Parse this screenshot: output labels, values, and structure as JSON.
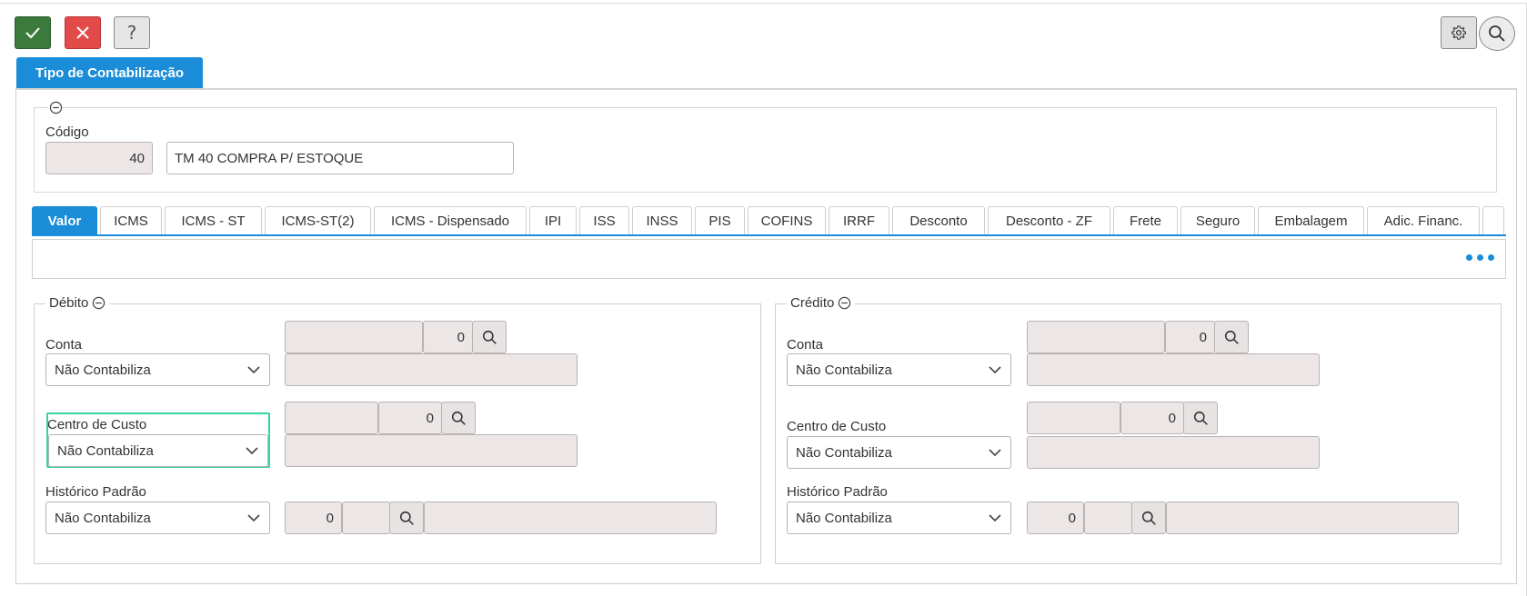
{
  "toolbar": {
    "ok_icon": "check-icon",
    "cancel_icon": "x-icon",
    "help_label": "?",
    "colors": {
      "ok": "#3a7a3a",
      "cancel": "#e34a4a",
      "accent": "#1a8cd8",
      "focus": "#33d6a0"
    }
  },
  "page": {
    "main_tab": "Tipo de Contabilização"
  },
  "header": {
    "code_label": "Código",
    "code_value": "40",
    "description_value": "TM 40 COMPRA P/ ESTOQUE"
  },
  "tabs": [
    {
      "label": "Valor",
      "active": true
    },
    {
      "label": "ICMS"
    },
    {
      "label": "ICMS - ST"
    },
    {
      "label": "ICMS-ST(2)"
    },
    {
      "label": "ICMS - Dispensado"
    },
    {
      "label": "IPI"
    },
    {
      "label": "ISS"
    },
    {
      "label": "INSS"
    },
    {
      "label": "PIS"
    },
    {
      "label": "COFINS"
    },
    {
      "label": "IRRF"
    },
    {
      "label": "Desconto"
    },
    {
      "label": "Desconto - ZF"
    },
    {
      "label": "Frete"
    },
    {
      "label": "Seguro"
    },
    {
      "label": "Embalagem"
    },
    {
      "label": "Adic. Financ."
    }
  ],
  "debito": {
    "title": "Débito",
    "conta": {
      "label": "Conta",
      "select": "Não Contabiliza",
      "code_value": "",
      "number_value": "0",
      "desc_value": ""
    },
    "centro": {
      "label": "Centro de Custo",
      "select": "Não Contabiliza",
      "code_value": "",
      "number_value": "0",
      "desc_value": ""
    },
    "historico": {
      "label": "Histórico Padrão",
      "select": "Não Contabiliza",
      "number_value": "0",
      "code_value": "",
      "desc_value": ""
    }
  },
  "credito": {
    "title": "Crédito",
    "conta": {
      "label": "Conta",
      "select": "Não Contabiliza",
      "code_value": "",
      "number_value": "0",
      "desc_value": ""
    },
    "centro": {
      "label": "Centro de Custo",
      "select": "Não Contabiliza",
      "code_value": "",
      "number_value": "0",
      "desc_value": ""
    },
    "historico": {
      "label": "Histórico Padrão",
      "select": "Não Contabiliza",
      "number_value": "0",
      "code_value": "",
      "desc_value": ""
    }
  }
}
